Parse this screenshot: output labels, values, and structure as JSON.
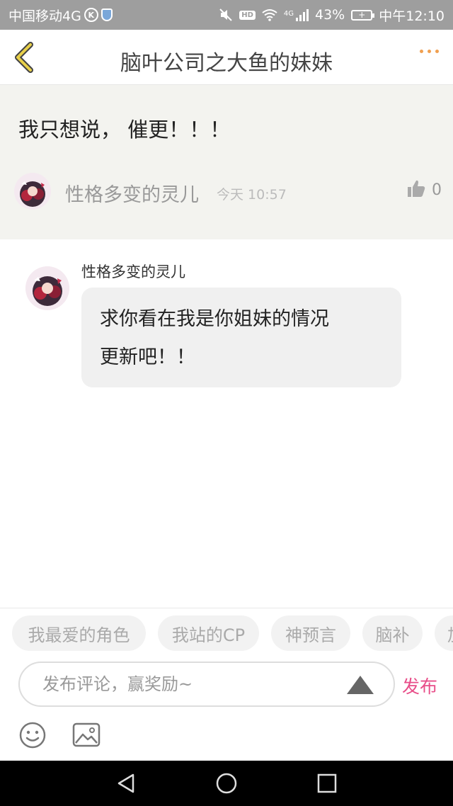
{
  "status_bar": {
    "carrier": "中国移动4G",
    "k_badge": "K",
    "hd_badge": "HD",
    "network": "4G",
    "battery_percent": "43%",
    "time": "中午12:10"
  },
  "nav": {
    "title": "脑叶公司之大鱼的妹妹"
  },
  "topic": {
    "text": "我只想说，  催更！！！",
    "author": "性格多变的灵儿",
    "time": "今天 10:57",
    "like_count": "0"
  },
  "comment": {
    "author": "性格多变的灵儿",
    "line1": "求你看在我是你姐妹的情况",
    "line2": "更新吧！！"
  },
  "tags": [
    "我最爱的角色",
    "我站的CP",
    "神预言",
    "脑补",
    "加"
  ],
  "composer": {
    "placeholder": "发布评论，赢奖励~",
    "publish_label": "发布"
  },
  "colors": {
    "accent": "#e84e89",
    "back_arrow": "#d4b42c",
    "more_dots": "#f0a050",
    "topic_bg": "#f3f3ef"
  }
}
